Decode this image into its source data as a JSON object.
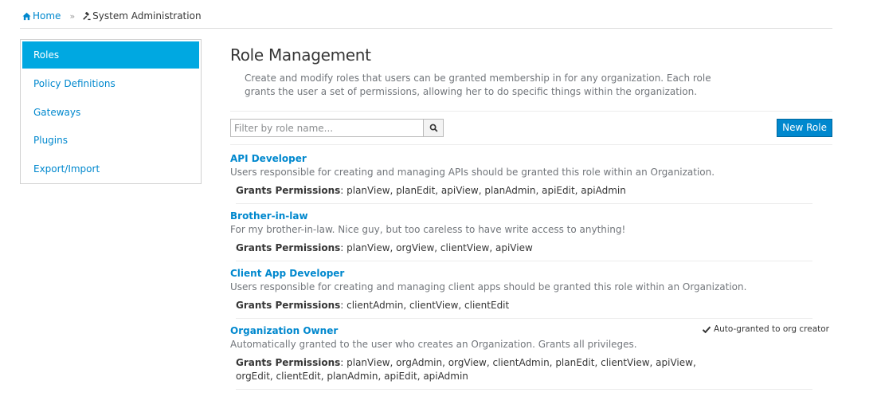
{
  "breadcrumb": {
    "home_label": "Home",
    "separator": "»",
    "current_label": "System Administration"
  },
  "sidebar": {
    "items": [
      {
        "label": "Roles",
        "active": true
      },
      {
        "label": "Policy Definitions",
        "active": false
      },
      {
        "label": "Gateways",
        "active": false
      },
      {
        "label": "Plugins",
        "active": false
      },
      {
        "label": "Export/Import",
        "active": false
      }
    ]
  },
  "main": {
    "title": "Role Management",
    "description": "Create and modify roles that users can be granted membership in for any organization. Each role grants the user a set of permissions, allowing her to do specific things within the organization.",
    "filter": {
      "placeholder": "Filter by role name...",
      "value": ""
    },
    "new_role_label": "New Role",
    "permissions_label": "Grants Permissions",
    "roles": [
      {
        "name": "API Developer",
        "description": "Users responsible for creating and managing APIs should be granted this role within an Organization.",
        "permissions": "planView, planEdit, apiView, planAdmin, apiEdit, apiAdmin",
        "badge": ""
      },
      {
        "name": "Brother-in-law",
        "description": "For my brother-in-law. Nice guy, but too careless to have write access to anything!",
        "permissions": "planView, orgView, clientView, apiView",
        "badge": ""
      },
      {
        "name": "Client App Developer",
        "description": "Users responsible for creating and managing client apps should be granted this role within an Organization.",
        "permissions": "clientAdmin, clientView, clientEdit",
        "badge": ""
      },
      {
        "name": "Organization Owner",
        "description": "Automatically granted to the user who creates an Organization. Grants all privileges.",
        "permissions": "planView, orgAdmin, orgView, clientAdmin, planEdit, clientView, apiView, orgEdit, clientEdit, planAdmin, apiEdit, apiAdmin",
        "badge": "Auto-granted to org creator"
      }
    ]
  }
}
